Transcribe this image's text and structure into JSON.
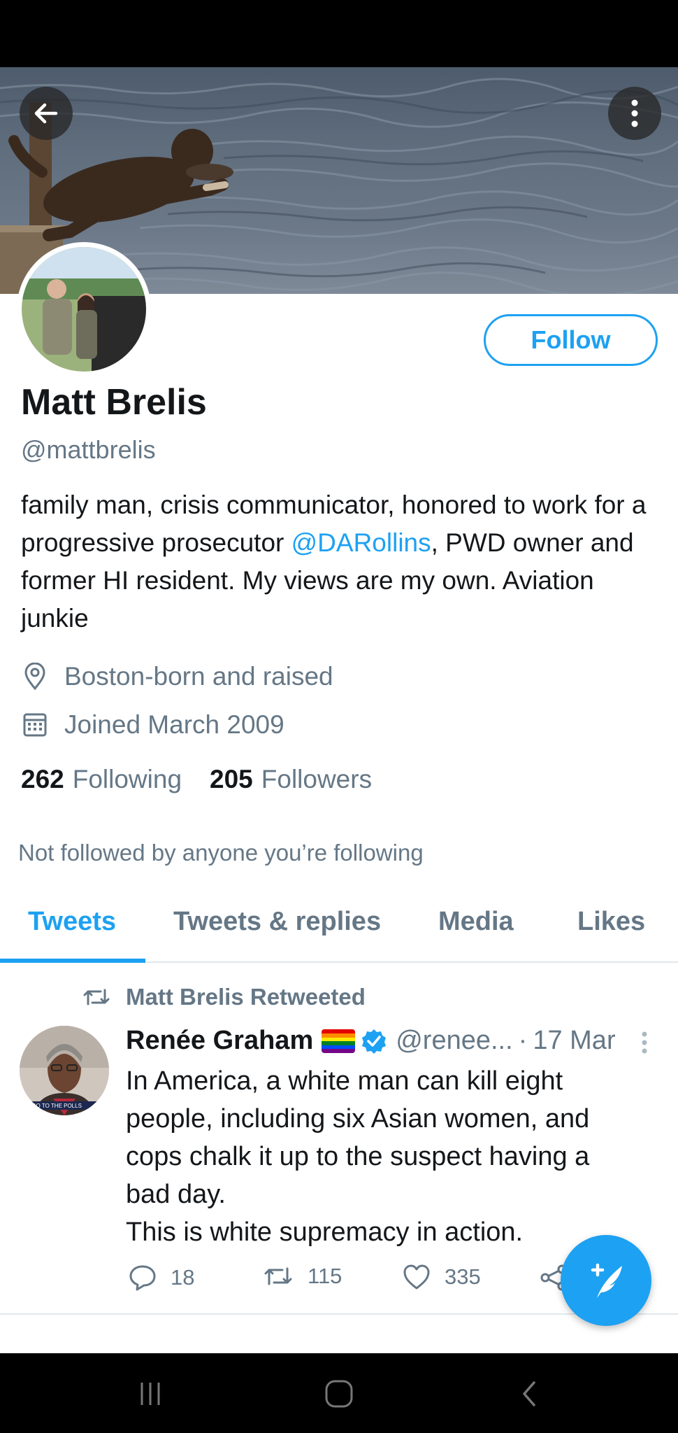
{
  "profile": {
    "name": "Matt Brelis",
    "handle": "@mattbrelis",
    "follow_label": "Follow",
    "bio_part1": "family man, crisis communicator, honored to work for a progressive prosecutor ",
    "bio_mention": "@DARollins",
    "bio_part2": ", PWD owner and former HI resident. My views are my own. Aviation junkie",
    "location": "Boston-born and raised",
    "joined": "Joined March 2009",
    "following_count": "262",
    "following_label": "Following",
    "followers_count": "205",
    "followers_label": "Followers",
    "not_followed_text": "Not followed by anyone you’re following"
  },
  "tabs": [
    {
      "label": "Tweets",
      "active": true
    },
    {
      "label": "Tweets & replies",
      "active": false
    },
    {
      "label": "Media",
      "active": false
    },
    {
      "label": "Likes",
      "active": false
    }
  ],
  "tweet": {
    "retweet_label": "Matt Brelis Retweeted",
    "author_name": "Renée Graham",
    "author_handle": "@renee...",
    "separator": "·",
    "date": "17 Mar",
    "lines": [
      "In America, a white man can kill eight",
      "people, including six Asian women, and",
      "cops chalk it up to the suspect having a",
      "bad day.",
      "This is white supremacy in action."
    ],
    "avatar_caption": "RS GO TO THE POLLS",
    "replies": "18",
    "retweets": "115",
    "likes": "335"
  },
  "icons": {
    "back": "arrow-left-icon",
    "more": "more-vertical-icon",
    "location": "location-pin-icon",
    "calendar": "calendar-icon",
    "retweet": "retweet-icon",
    "reply": "reply-icon",
    "like": "heart-icon",
    "share": "share-icon",
    "compose": "compose-tweet-icon",
    "verified": "verified-badge-icon",
    "pride_flag": "rainbow-flag-icon"
  },
  "colors": {
    "accent": "#1da1f2",
    "secondary_text": "#657786",
    "primary_text": "#14171a"
  }
}
